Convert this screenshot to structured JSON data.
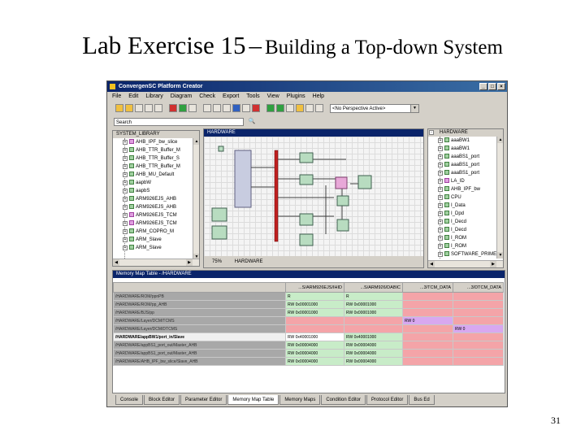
{
  "slide": {
    "title_main": "Lab Exercise 15",
    "title_dash": "–",
    "title_rest": "Building a Top-down System",
    "page_number": "31"
  },
  "window": {
    "title": "ConvergenSC Platform Creator",
    "controls": [
      "_",
      "□",
      "×"
    ],
    "menu": [
      "File",
      "Edit",
      "Library",
      "Diagram",
      "Check",
      "Export",
      "Tools",
      "View",
      "Plugins",
      "Help"
    ],
    "perspective": "<No Perspective Active>",
    "search_label": "Search",
    "search_button": "🔍"
  },
  "library": {
    "header": "SYSTEM_LIBRARY",
    "items": [
      {
        "label": "AHB_IPF_bw_slice",
        "icon": "pink"
      },
      {
        "label": "AHB_TTR_Buffer_M",
        "icon": "green"
      },
      {
        "label": "AHB_TTR_Buffer_S",
        "icon": "green"
      },
      {
        "label": "AHB_TTR_Buffer_M",
        "icon": "green"
      },
      {
        "label": "AHB_MU_Default",
        "icon": "green"
      },
      {
        "label": "aapbW",
        "icon": "green"
      },
      {
        "label": "aapbS",
        "icon": "green"
      },
      {
        "label": "ARM926EJS_AHB",
        "icon": "green"
      },
      {
        "label": "ARM926EJS_AHB",
        "icon": "green"
      },
      {
        "label": "ARM926EJS_TCM",
        "icon": "pink"
      },
      {
        "label": "ARM926EJS_TCM",
        "icon": "pink"
      },
      {
        "label": "ARM_COPRO_M",
        "icon": "green"
      },
      {
        "label": "ARM_Slave",
        "icon": "green"
      },
      {
        "label": "ARM_Slave",
        "icon": "green"
      }
    ]
  },
  "diagram": {
    "header": "HARDWARE",
    "zoom": "75%",
    "footer_tab": "HARDWARE"
  },
  "hardware_tree": {
    "header": "HARDWARE",
    "items": [
      {
        "label": "aaaBW1",
        "icon": "green"
      },
      {
        "label": "aaaBW1",
        "icon": "green"
      },
      {
        "label": "aaaBS1_port",
        "icon": "green"
      },
      {
        "label": "aaaBS1_port",
        "icon": "green"
      },
      {
        "label": "aaaBS1_port",
        "icon": "green"
      },
      {
        "label": "LA_ID",
        "icon": "pink"
      },
      {
        "label": "AHB_IPF_bw",
        "icon": "green"
      },
      {
        "label": "CPU",
        "icon": "green"
      },
      {
        "label": "I_Data",
        "icon": "green"
      },
      {
        "label": "I_Dpd",
        "icon": "green"
      },
      {
        "label": "I_Decd",
        "icon": "green"
      },
      {
        "label": "I_Decd",
        "icon": "green"
      },
      {
        "label": "I_ROM",
        "icon": "green"
      },
      {
        "label": "I_ROM",
        "icon": "green"
      },
      {
        "label": "SOFTWARE_PRIME",
        "icon": "green"
      }
    ]
  },
  "memory_map": {
    "header": "Memory Map Table - /HARDWARE",
    "columns": [
      "",
      "...S/ARM926EJS/IHID",
      "...S/ARM926/DABIC",
      "...3/TCM_DATA",
      "...3/DTCM_DATA"
    ],
    "rows": [
      {
        "label": "/HARDWARE/ROM/ppnPB",
        "highlight": false,
        "cells": [
          {
            "t": "R",
            "c": "g"
          },
          {
            "t": "R",
            "c": "g"
          },
          {
            "t": "",
            "c": "r"
          },
          {
            "t": "",
            "c": "r"
          }
        ]
      },
      {
        "label": "/HARDWARE/ROM/pp_AHB",
        "highlight": false,
        "cells": [
          {
            "t": "RW 0x00001000",
            "c": "g"
          },
          {
            "t": "RW 0x00001000",
            "c": "g"
          },
          {
            "t": "",
            "c": "r"
          },
          {
            "t": "",
            "c": "r"
          }
        ]
      },
      {
        "label": "/HARDWARE/BJS/pp",
        "highlight": false,
        "cells": [
          {
            "t": "RW 0x00001000",
            "c": "g"
          },
          {
            "t": "RW 0x00001000",
            "c": "g"
          },
          {
            "t": "",
            "c": "r"
          },
          {
            "t": "",
            "c": "r"
          }
        ]
      },
      {
        "label": "/HARDWARE/Layer/DCM/TCMS",
        "highlight": false,
        "cells": [
          {
            "t": "",
            "c": "r"
          },
          {
            "t": "",
            "c": "r"
          },
          {
            "t": "RW 0",
            "c": "p"
          },
          {
            "t": "",
            "c": "r"
          }
        ]
      },
      {
        "label": "/HARDWARE/Layer/DCM/DTCMS",
        "highlight": false,
        "cells": [
          {
            "t": "",
            "c": "r"
          },
          {
            "t": "",
            "c": "r"
          },
          {
            "t": "",
            "c": "r"
          },
          {
            "t": "RW 0",
            "c": "p"
          }
        ]
      },
      {
        "label": "/HARDWARE/appBW1/port_in/Slave",
        "highlight": true,
        "cells": [
          {
            "t": "RW 0x40001000",
            "c": "w"
          },
          {
            "t": "RW 0x40001000",
            "c": "g"
          },
          {
            "t": "",
            "c": "r"
          },
          {
            "t": "",
            "c": "r"
          }
        ]
      },
      {
        "label": "/HARDWARE/appBS1_port_out/Master_AHB",
        "highlight": false,
        "cells": [
          {
            "t": "RW 0x00004000",
            "c": "g"
          },
          {
            "t": "RW 0x00004000",
            "c": "g"
          },
          {
            "t": "",
            "c": "r"
          },
          {
            "t": "",
            "c": "r"
          }
        ]
      },
      {
        "label": "/HARDWARE/appBS1_port_out/Master_AHB",
        "highlight": false,
        "cells": [
          {
            "t": "RW 0x00004000",
            "c": "g"
          },
          {
            "t": "RW 0x00004000",
            "c": "g"
          },
          {
            "t": "",
            "c": "r"
          },
          {
            "t": "",
            "c": "r"
          }
        ]
      },
      {
        "label": "/HARDWARE/AHB_IPF_bw_slice/Slave_AHB",
        "highlight": false,
        "cells": [
          {
            "t": "RW 0x00004000",
            "c": "g"
          },
          {
            "t": "RW 0x00004000",
            "c": "g"
          },
          {
            "t": "",
            "c": "r"
          },
          {
            "t": "",
            "c": "r"
          }
        ]
      }
    ]
  },
  "tabs": [
    {
      "label": "Console",
      "active": false
    },
    {
      "label": "Block Editor",
      "active": false
    },
    {
      "label": "Parameter Editor",
      "active": false
    },
    {
      "label": "Memory Map Table",
      "active": true
    },
    {
      "label": "Memory Maps",
      "active": false
    },
    {
      "label": "Condition Editor",
      "active": false
    },
    {
      "label": "Protocol Editor",
      "active": false
    },
    {
      "label": "Bus Ed",
      "active": false
    }
  ],
  "colors": {
    "accessible": "#c8ecc8",
    "inaccessible": "#f4a4a8",
    "selected": "#d8a8f0",
    "bus": "#c02020",
    "titlebar": "#0a246a"
  }
}
